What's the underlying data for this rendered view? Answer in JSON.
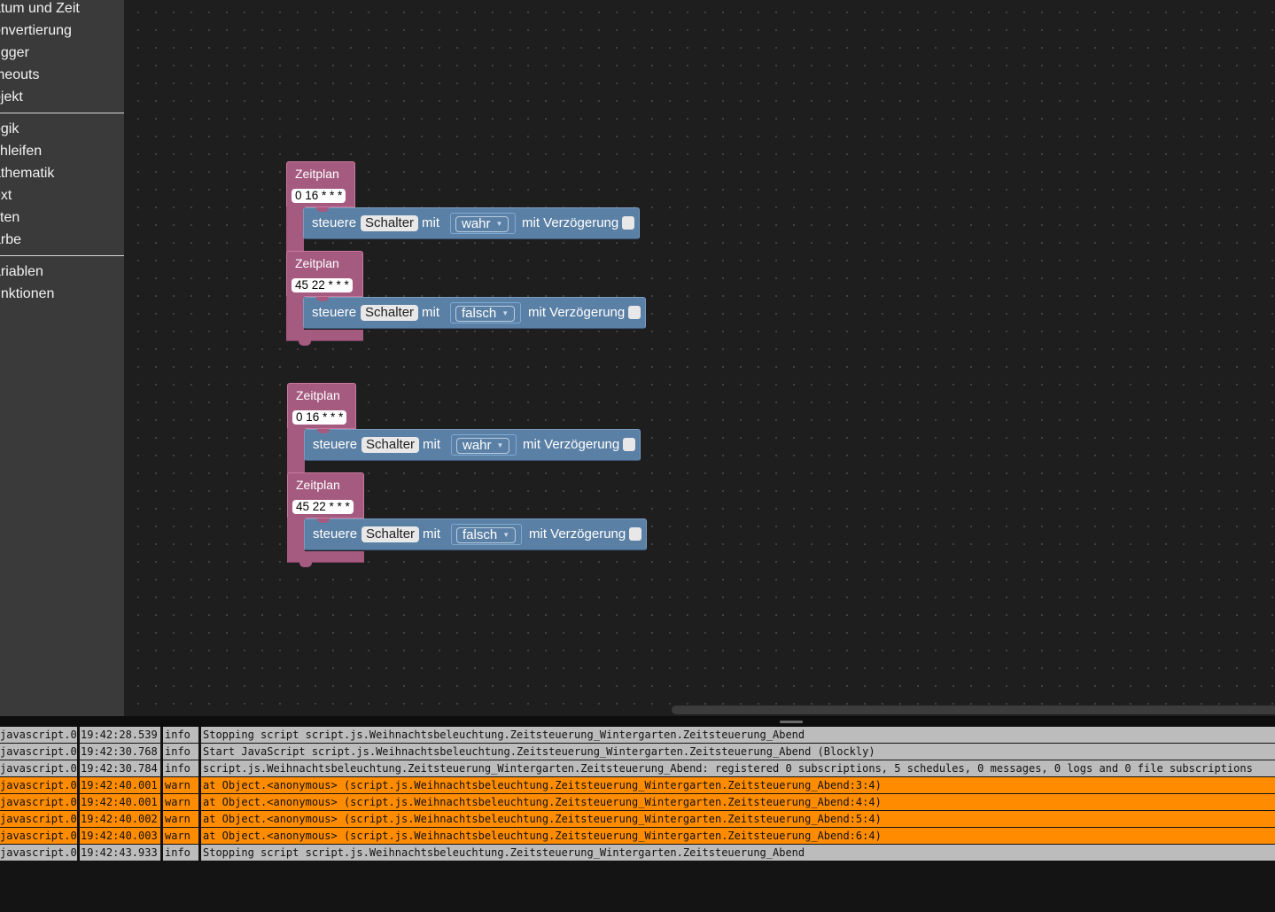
{
  "sidebar": {
    "categories_group1": [
      "atum und Zeit",
      "onvertierung",
      "rigger",
      "meouts",
      "bjekt"
    ],
    "categories_group2": [
      "ogik",
      "chleifen",
      "athematik",
      "ext",
      "sten",
      "arbe"
    ],
    "categories_group3": [
      "ariablen",
      "unktionen"
    ]
  },
  "workspace": {
    "blocks": [
      {
        "title": "Zeitplan",
        "cron": "0 16 * * *",
        "steuere": "steuere",
        "device": "Schalter",
        "mit": "mit",
        "value": "wahr",
        "delay_label": "mit Verzögerung"
      },
      {
        "title": "Zeitplan",
        "cron": "45 22 * * *",
        "steuere": "steuere",
        "device": "Schalter",
        "mit": "mit",
        "value": "falsch",
        "delay_label": "mit Verzögerung"
      },
      {
        "title": "Zeitplan",
        "cron": "0 16 * * *",
        "steuere": "steuere",
        "device": "Schalter",
        "mit": "mit",
        "value": "wahr",
        "delay_label": "mit Verzögerung"
      },
      {
        "title": "Zeitplan",
        "cron": "45 22 * * *",
        "steuere": "steuere",
        "device": "Schalter",
        "mit": "mit",
        "value": "falsch",
        "delay_label": "mit Verzögerung"
      }
    ]
  },
  "log": {
    "rows": [
      {
        "source": "javascript.0",
        "time": "19:42:28.539",
        "level": "info",
        "message": "Stopping script script.js.Weihnachtsbeleuchtung.Zeitsteuerung_Wintergarten.Zeitsteuerung_Abend"
      },
      {
        "source": "javascript.0",
        "time": "19:42:30.768",
        "level": "info",
        "message": "Start JavaScript script.js.Weihnachtsbeleuchtung.Zeitsteuerung_Wintergarten.Zeitsteuerung_Abend (Blockly)"
      },
      {
        "source": "javascript.0",
        "time": "19:42:30.784",
        "level": "info",
        "message": "script.js.Weihnachtsbeleuchtung.Zeitsteuerung_Wintergarten.Zeitsteuerung_Abend: registered 0 subscriptions, 5 schedules, 0 messages, 0 logs and 0 file subscriptions"
      },
      {
        "source": "javascript.0",
        "time": "19:42:40.001",
        "level": "warn",
        "message": "at Object.<anonymous> (script.js.Weihnachtsbeleuchtung.Zeitsteuerung_Wintergarten.Zeitsteuerung_Abend:3:4)"
      },
      {
        "source": "javascript.0",
        "time": "19:42:40.001",
        "level": "warn",
        "message": "at Object.<anonymous> (script.js.Weihnachtsbeleuchtung.Zeitsteuerung_Wintergarten.Zeitsteuerung_Abend:4:4)"
      },
      {
        "source": "javascript.0",
        "time": "19:42:40.002",
        "level": "warn",
        "message": "at Object.<anonymous> (script.js.Weihnachtsbeleuchtung.Zeitsteuerung_Wintergarten.Zeitsteuerung_Abend:5:4)"
      },
      {
        "source": "javascript.0",
        "time": "19:42:40.003",
        "level": "warn",
        "message": "at Object.<anonymous> (script.js.Weihnachtsbeleuchtung.Zeitsteuerung_Wintergarten.Zeitsteuerung_Abend:6:4)"
      },
      {
        "source": "javascript.0",
        "time": "19:42:43.933",
        "level": "info",
        "message": "Stopping script script.js.Weihnachtsbeleuchtung.Zeitsteuerung_Wintergarten.Zeitsteuerung_Abend"
      }
    ]
  },
  "colors": {
    "schedule_block": "#a55b80",
    "control_block": "#5b80a5",
    "log_info": "#bcbcbc",
    "log_warn": "#ff8c00"
  }
}
